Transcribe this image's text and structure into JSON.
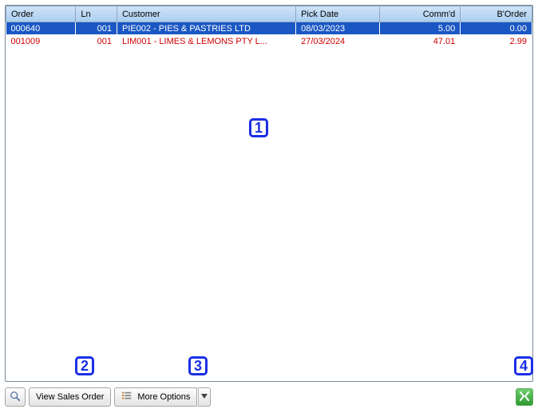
{
  "grid": {
    "columns": {
      "order": "Order",
      "ln": "Ln",
      "customer": "Customer",
      "pickDate": "Pick Date",
      "commd": "Comm'd",
      "border": "B'Order"
    },
    "rows": [
      {
        "order": "000640",
        "ln": "001",
        "customer": "PIE002 - PIES & PASTRIES LTD",
        "pickDate": "08/03/2023",
        "commd": "5.00",
        "border": "0.00",
        "selected": true,
        "backorder": false
      },
      {
        "order": "001009",
        "ln": "001",
        "customer": "LIM001 - LIMES & LEMONS PTY L...",
        "pickDate": "27/03/2024",
        "commd": "47.01",
        "border": "2.99",
        "selected": false,
        "backorder": true
      }
    ]
  },
  "toolbar": {
    "viewSalesOrder": "View Sales Order",
    "moreOptions": "More Options"
  },
  "annotations": {
    "a1": "1",
    "a2": "2",
    "a3": "3",
    "a4": "4"
  }
}
